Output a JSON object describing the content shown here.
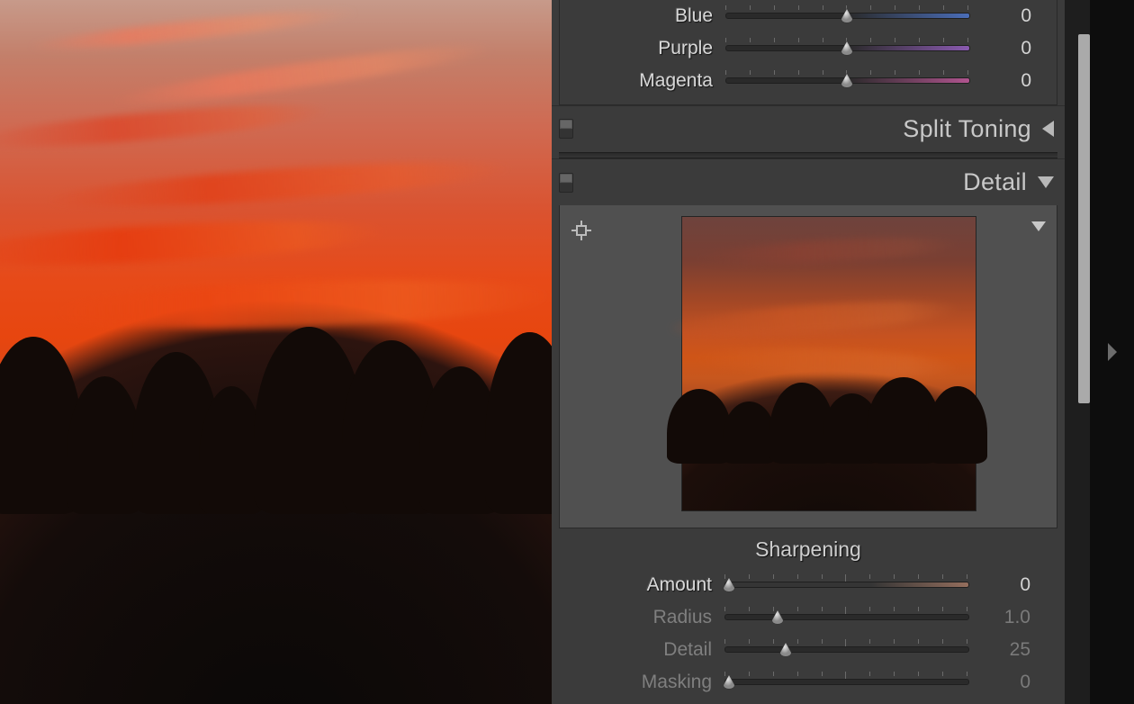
{
  "color_sliders": [
    {
      "label": "Blue",
      "value": "0",
      "pos": 50,
      "gradient": "grad-blue"
    },
    {
      "label": "Purple",
      "value": "0",
      "pos": 50,
      "gradient": "grad-purple"
    },
    {
      "label": "Magenta",
      "value": "0",
      "pos": 50,
      "gradient": "grad-magenta"
    }
  ],
  "panels": {
    "split_toning": {
      "title": "Split Toning",
      "expanded": false
    },
    "detail": {
      "title": "Detail",
      "expanded": true
    }
  },
  "sharpening": {
    "title": "Sharpening",
    "sliders": [
      {
        "label": "Amount",
        "value": "0",
        "pos": 2,
        "active": true,
        "gradient": "grad-amount"
      },
      {
        "label": "Radius",
        "value": "1.0",
        "pos": 22,
        "active": false,
        "gradient": ""
      },
      {
        "label": "Detail",
        "value": "25",
        "pos": 25,
        "active": false,
        "gradient": ""
      },
      {
        "label": "Masking",
        "value": "0",
        "pos": 2,
        "active": false,
        "gradient": ""
      }
    ]
  }
}
